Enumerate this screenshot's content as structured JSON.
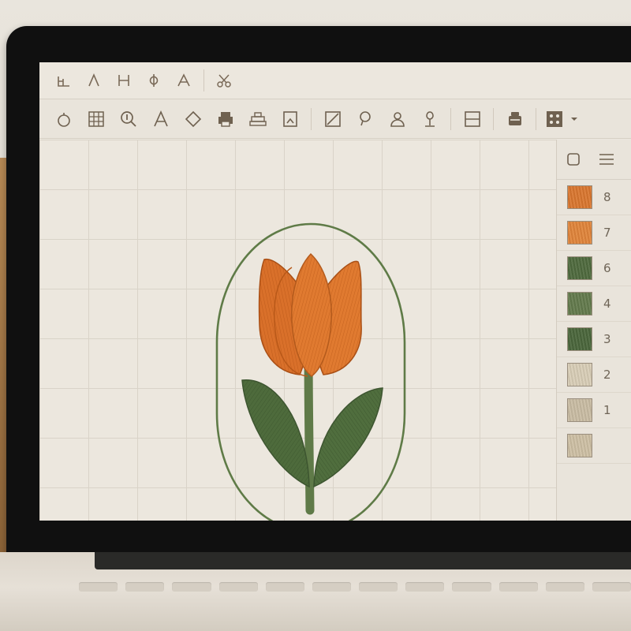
{
  "toolbar_top": {
    "icons": [
      "⫡",
      "Λ",
      "H",
      "ↀ",
      "A",
      "scissors"
    ]
  },
  "toolbar_main": {
    "tools": [
      "circle-tool",
      "grid-tool",
      "zoom-tool",
      "text-tool",
      "diamond-tool",
      "print-tool",
      "machine-tool",
      "bookmark-tool",
      "fill-tool",
      "lasso-tool",
      "person-tool",
      "stitch-tool",
      "split-tool",
      "hoop-tool",
      "palette-dropdown"
    ]
  },
  "palette": {
    "swatches": [
      {
        "label": "8",
        "color": "#d9762f"
      },
      {
        "label": "7",
        "color": "#e0843a"
      },
      {
        "label": "6",
        "color": "#4f6a3e"
      },
      {
        "label": "4",
        "color": "#637a4c"
      },
      {
        "label": "3",
        "color": "#4a663b"
      },
      {
        "label": "2",
        "color": "#d8cdb6"
      },
      {
        "label": "1",
        "color": "#c9bca3"
      },
      {
        "label": "",
        "color": "#cdbfa4"
      }
    ]
  },
  "colors": {
    "petal": "#d96f24",
    "petal_dark": "#b85818",
    "leaf": "#4e6b3c",
    "stem": "#5f7a48",
    "hoop": "#5c7a45",
    "icon": "#6f6150"
  }
}
